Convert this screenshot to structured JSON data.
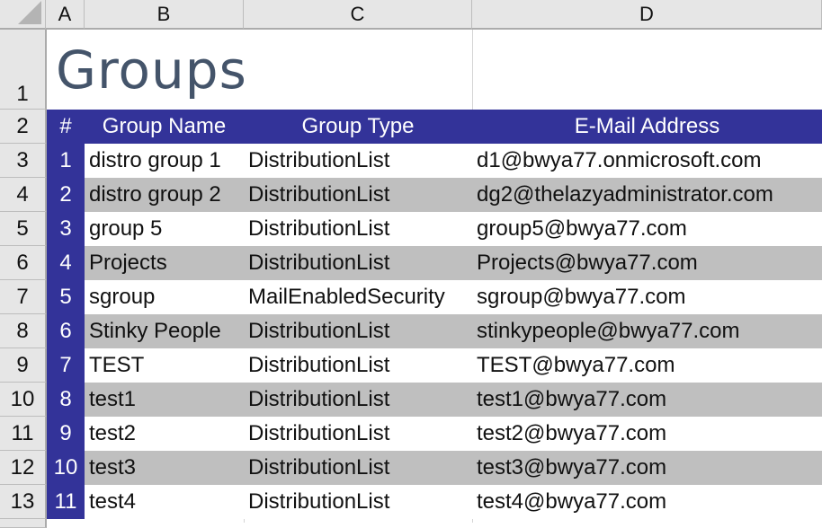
{
  "columns": [
    "A",
    "B",
    "C",
    "D"
  ],
  "row_numbers": [
    "1",
    "2",
    "3",
    "4",
    "5",
    "6",
    "7",
    "8",
    "9",
    "10",
    "11",
    "12",
    "13"
  ],
  "title": "Groups",
  "table": {
    "headers": {
      "index": "#",
      "name": "Group Name",
      "type": "Group Type",
      "email": "E-Mail Address"
    },
    "rows": [
      {
        "index": "1",
        "name": "distro group 1",
        "type": "DistributionList",
        "email": "d1@bwya77.onmicrosoft.com"
      },
      {
        "index": "2",
        "name": "distro group 2",
        "type": "DistributionList",
        "email": "dg2@thelazyadministrator.com"
      },
      {
        "index": "3",
        "name": "group 5",
        "type": "DistributionList",
        "email": "group5@bwya77.com"
      },
      {
        "index": "4",
        "name": "Projects",
        "type": "DistributionList",
        "email": "Projects@bwya77.com"
      },
      {
        "index": "5",
        "name": "sgroup",
        "type": "MailEnabledSecurity",
        "email": "sgroup@bwya77.com"
      },
      {
        "index": "6",
        "name": "Stinky People",
        "type": "DistributionList",
        "email": "stinkypeople@bwya77.com"
      },
      {
        "index": "7",
        "name": "TEST",
        "type": "DistributionList",
        "email": "TEST@bwya77.com"
      },
      {
        "index": "8",
        "name": "test1",
        "type": "DistributionList",
        "email": "test1@bwya77.com"
      },
      {
        "index": "9",
        "name": "test2",
        "type": "DistributionList",
        "email": "test2@bwya77.com"
      },
      {
        "index": "10",
        "name": "test3",
        "type": "DistributionList",
        "email": "test3@bwya77.com"
      },
      {
        "index": "11",
        "name": "test4",
        "type": "DistributionList",
        "email": "test4@bwya77.com"
      }
    ]
  },
  "colors": {
    "header_band": "#333399",
    "alt_row": "#bfbfbf",
    "title": "#44546a"
  }
}
